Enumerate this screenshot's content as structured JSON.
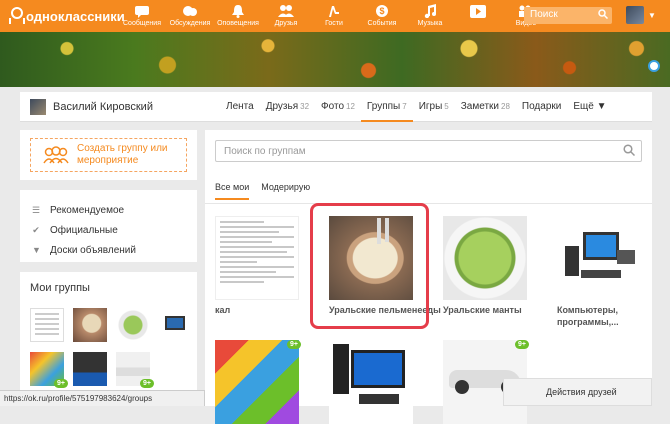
{
  "brand": {
    "name": "одноклассники"
  },
  "nav": [
    {
      "label": "Сообщения",
      "icon": "message-icon"
    },
    {
      "label": "Обсуждения",
      "icon": "discussion-icon"
    },
    {
      "label": "Оповещения",
      "icon": "bell-icon"
    },
    {
      "label": "Друзья",
      "icon": "friends-icon"
    },
    {
      "label": "Гости",
      "icon": "guests-icon"
    },
    {
      "label": "События",
      "icon": "events-icon"
    },
    {
      "label": "Музыка",
      "icon": "music-icon"
    },
    {
      "label": "",
      "icon": "video-play-icon"
    },
    {
      "label": "Видео",
      "icon": "video-icon"
    }
  ],
  "search": {
    "placeholder": "Поиск"
  },
  "profile": {
    "name": "Василий Кировский",
    "tabs": [
      {
        "label": "Лента",
        "count": ""
      },
      {
        "label": "Друзья",
        "count": "32"
      },
      {
        "label": "Фото",
        "count": "12"
      },
      {
        "label": "Группы",
        "count": "7",
        "active": true
      },
      {
        "label": "Игры",
        "count": "5"
      },
      {
        "label": "Заметки",
        "count": "28"
      },
      {
        "label": "Подарки",
        "count": ""
      },
      {
        "label": "Ещё ▼",
        "count": ""
      }
    ]
  },
  "create_group": {
    "label": "Создать группу или мероприятие"
  },
  "menu": [
    {
      "label": "Рекомендуемое",
      "icon": "list-icon"
    },
    {
      "label": "Официальные",
      "icon": "check-icon"
    },
    {
      "label": "Доски объявлений",
      "icon": "pin-icon"
    }
  ],
  "my_groups": {
    "title": "Мои группы",
    "badges": [
      "9+",
      "9+"
    ]
  },
  "groups_search": {
    "placeholder": "Поиск по группам"
  },
  "group_tabs": [
    {
      "label": "Все мои",
      "active": true
    },
    {
      "label": "Модерирую"
    }
  ],
  "groups": [
    {
      "title": "кал"
    },
    {
      "title": "Уральские пельменееды"
    },
    {
      "title": "Уральские манты"
    },
    {
      "title": "Компьютеры, программы,..."
    }
  ],
  "second_row_badges": [
    "9+",
    "9+"
  ],
  "friends_actions": {
    "label": "Действия друзей"
  },
  "status_url": "https://ok.ru/profile/575197983624/groups",
  "colors": {
    "accent": "#f58a1f",
    "highlight": "#e53d4a",
    "badge": "#6cbf2a"
  }
}
